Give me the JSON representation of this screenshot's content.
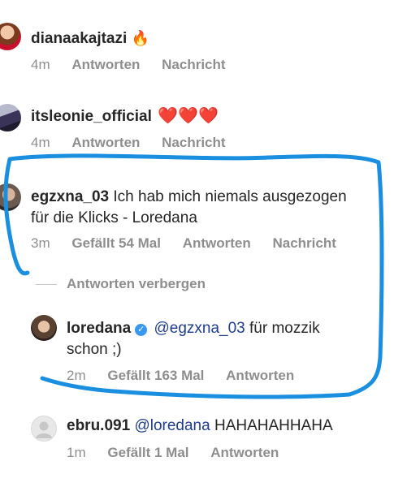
{
  "comments": [
    {
      "username": "dianaakajtazi",
      "text": "",
      "emoji": "🔥",
      "time": "4m",
      "reply": "Antworten",
      "message": "Nachricht"
    },
    {
      "username": "itsleonie_official",
      "text": "",
      "emoji": "❤️❤️❤️",
      "time": "4m",
      "reply": "Antworten",
      "message": "Nachricht"
    },
    {
      "username": "egzxna_03",
      "text": "Ich hab mich niemals ausgezogen für die Klicks - Loredana",
      "time": "3m",
      "likes": "Gefällt 54 Mal",
      "reply": "Antworten",
      "message": "Nachricht"
    }
  ],
  "hide_replies_label": "Antworten verbergen",
  "replies": [
    {
      "username": "loredana",
      "verified": true,
      "mention": "@egzxna_03",
      "text": "für mozzik schon ;)",
      "time": "2m",
      "likes": "Gefällt 163 Mal",
      "reply": "Antworten"
    }
  ],
  "bottom_comment": {
    "username": "ebru.091",
    "mention": "@loredana",
    "text": "HAHAHAHHAHA",
    "time": "1m",
    "likes": "Gefällt 1 Mal",
    "reply": "Antworten"
  },
  "colors": {
    "highlight": "#1a8fe0",
    "meta_gray": "#8e8e8e",
    "mention_blue": "#1f3d8a",
    "heart_red": "#e1142b"
  }
}
